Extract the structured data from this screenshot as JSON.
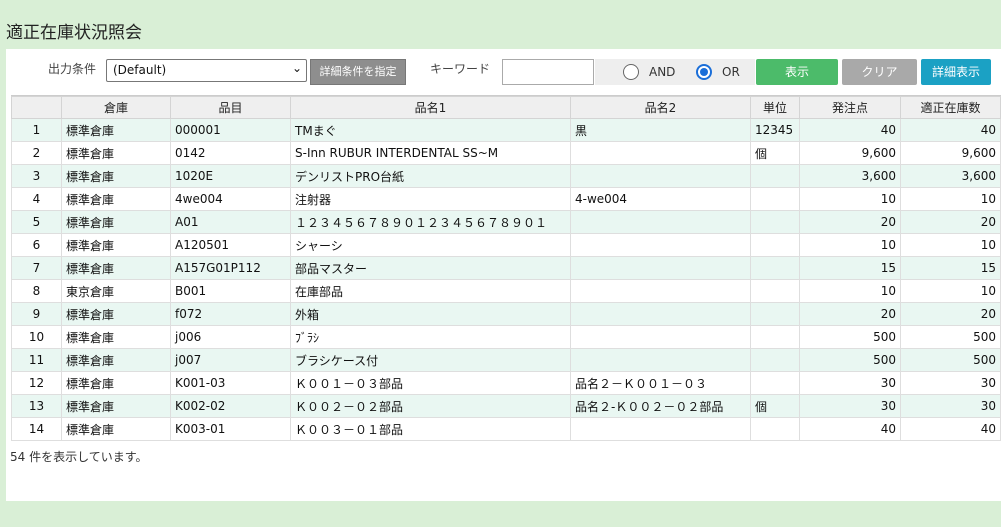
{
  "page_title": "適正在庫状況照会",
  "toolbar": {
    "output_condition_label": "出力条件",
    "output_condition_value": "(Default)",
    "detail_condition_button": "詳細条件を指定",
    "keyword_label": "キーワード",
    "keyword_value": "",
    "radio_and_label": "AND",
    "radio_or_label": "OR",
    "radio_selected": "OR",
    "show_button": "表示",
    "clear_button": "クリア",
    "detail_view_button": "詳細表示"
  },
  "table": {
    "headers": [
      "",
      "倉庫",
      "品目",
      "品名1",
      "品名2",
      "単位",
      "発注点",
      "適正在庫数"
    ],
    "rows": [
      [
        "1",
        "標準倉庫",
        "000001",
        "TMまぐ",
        "黒",
        "12345",
        "40",
        "40"
      ],
      [
        "2",
        "標準倉庫",
        "0142",
        "S-Inn RUBUR INTERDENTAL SS~M",
        "",
        "個",
        "9,600",
        "9,600"
      ],
      [
        "3",
        "標準倉庫",
        "1020E",
        "デンリストPRO台紙",
        "",
        "",
        "3,600",
        "3,600"
      ],
      [
        "4",
        "標準倉庫",
        "4we004",
        "注射器",
        "4-we004",
        "",
        "10",
        "10"
      ],
      [
        "5",
        "標準倉庫",
        "A01",
        "１２３４５６７８９０１２３４５６７８９０１",
        "",
        "",
        "20",
        "20"
      ],
      [
        "6",
        "標準倉庫",
        "A120501",
        "シャーシ",
        "",
        "",
        "10",
        "10"
      ],
      [
        "7",
        "標準倉庫",
        "A157G01P112",
        "部品マスター",
        "",
        "",
        "15",
        "15"
      ],
      [
        "8",
        "東京倉庫",
        "B001",
        "在庫部品",
        "",
        "",
        "10",
        "10"
      ],
      [
        "9",
        "標準倉庫",
        "f072",
        "外箱",
        "",
        "",
        "20",
        "20"
      ],
      [
        "10",
        "標準倉庫",
        "j006",
        "ﾌﾞﾗｼ",
        "",
        "",
        "500",
        "500"
      ],
      [
        "11",
        "標準倉庫",
        "j007",
        "ブラシケース付",
        "",
        "",
        "500",
        "500"
      ],
      [
        "12",
        "標準倉庫",
        "K001-03",
        "Ｋ００１－０３部品",
        "品名２－Ｋ００１－０３",
        "",
        "30",
        "30"
      ],
      [
        "13",
        "標準倉庫",
        "K002-02",
        "Ｋ００２－０２部品",
        "品名２-Ｋ００２－０２部品",
        "個",
        "30",
        "30"
      ],
      [
        "14",
        "標準倉庫",
        "K003-01",
        "Ｋ００３－０１部品",
        "",
        "",
        "40",
        "40"
      ]
    ]
  },
  "status_text": "54 件を表示しています。"
}
